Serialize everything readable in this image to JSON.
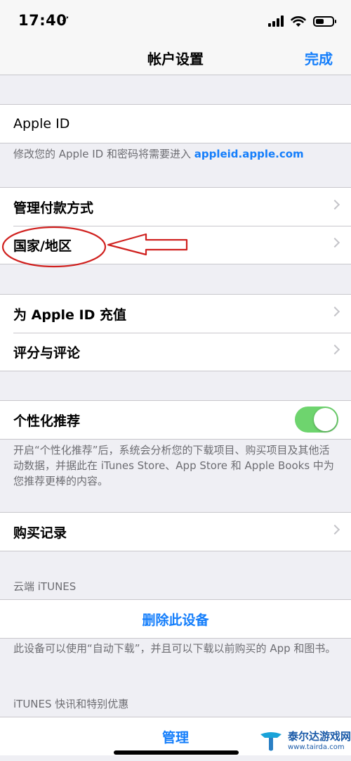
{
  "status_bar": {
    "time": "17:40",
    "location_glyph": "➶"
  },
  "nav": {
    "title": "帐户设置",
    "done": "完成"
  },
  "apple_id_group": {
    "label": "Apple ID"
  },
  "apple_id_footer": {
    "text": "修改您的 Apple ID 和密码将需要进入 ",
    "link": "appleid.apple.com"
  },
  "payment_group": {
    "items": [
      {
        "label": "管理付款方式"
      },
      {
        "label": "国家/地区"
      }
    ]
  },
  "recharge_group": {
    "items": [
      {
        "label": "为 Apple ID 充值"
      },
      {
        "label": "评分与评论"
      }
    ]
  },
  "personalization": {
    "label": "个性化推荐",
    "enabled": true,
    "footer": "开启“个性化推荐”后，系统会分析您的下载项目、购买项目及其他活动数据，并据此在 iTunes Store、App Store 和 Apple Books 中为您推荐更棒的内容。"
  },
  "purchase_history": {
    "label": "购买记录"
  },
  "cloud_itunes": {
    "header": "云端 iTUNES",
    "remove_device": "删除此设备",
    "footer": "此设备可以使用“自动下载”，并且可以下载以前购买的 App 和图书。"
  },
  "itunes_news": {
    "header": "iTUNES 快讯和特别优惠",
    "manage": "管理"
  },
  "watermark": {
    "name": "泰尔达游戏网",
    "url": "www.tairda.com"
  },
  "colors": {
    "accent": "#147efb",
    "toggle_on": "#6ed46e",
    "annotation": "#d0211f",
    "background": "#efeff4"
  },
  "icons": [
    "location-arrow-icon",
    "signal-icon",
    "wifi-icon",
    "battery-icon",
    "chevron-right-icon"
  ]
}
